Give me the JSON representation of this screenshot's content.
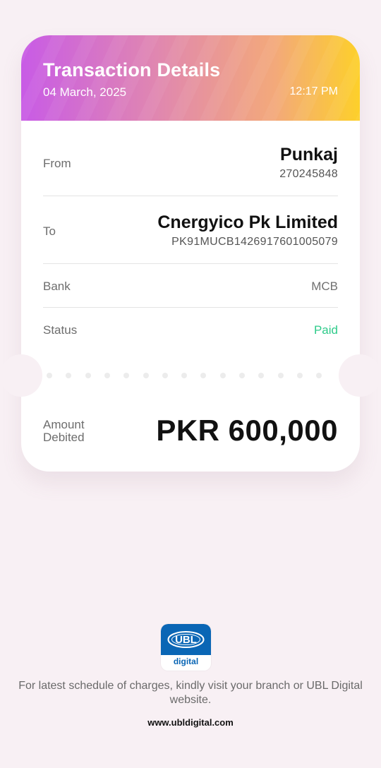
{
  "header": {
    "title": "Transaction Details",
    "date": "04 March, 2025",
    "time": "12:17 PM"
  },
  "from": {
    "label": "From",
    "name": "Punkaj",
    "account": "270245848"
  },
  "to": {
    "label": "To",
    "name": "Cnergyico Pk Limited",
    "account": "PK91MUCB1426917601005079"
  },
  "bank": {
    "label": "Bank",
    "value": "MCB"
  },
  "status": {
    "label": "Status",
    "value": "Paid",
    "color": "#2ecb8a"
  },
  "amount": {
    "label": "Amount Debited",
    "value": "PKR 600,000"
  },
  "footer": {
    "logo_top": "UBL",
    "logo_bottom": "digital",
    "note": "For latest schedule of charges, kindly visit your branch or UBL Digital website.",
    "website": "www.ubldigital.com"
  },
  "colors": {
    "gradient_start": "#c85be6",
    "gradient_end": "#fdd02a",
    "ubl_blue": "#0a66b5"
  }
}
